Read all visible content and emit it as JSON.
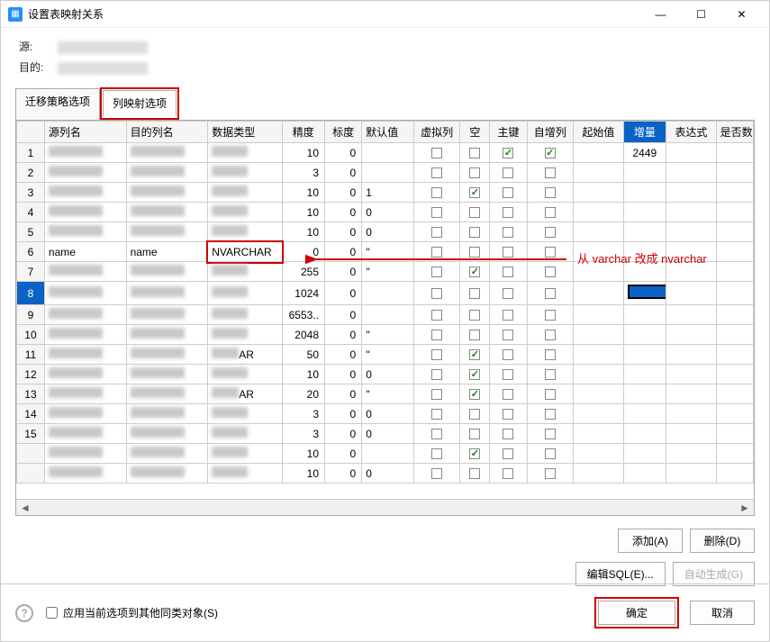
{
  "window": {
    "title": "设置表映射关系",
    "minimize": "—",
    "maximize": "☐",
    "close": "✕"
  },
  "header": {
    "source_label": "源:",
    "target_label": "目的:"
  },
  "tabs": {
    "strategy": "迁移策略选项",
    "mapping": "列映射选项"
  },
  "columns": {
    "rownum": "",
    "src": "源列名",
    "dst": "目的列名",
    "dtype": "数据类型",
    "precision": "精度",
    "scale": "标度",
    "default": "默认值",
    "virtual": "虚拟列",
    "nullable": "空",
    "pk": "主键",
    "autoinc": "自增列",
    "start": "起始值",
    "incr": "增量",
    "expr": "表达式",
    "isnum": "是否数"
  },
  "rows": [
    {
      "n": "1",
      "src": "blur",
      "dst": "blur",
      "dtype": "blur",
      "prec": "10",
      "scale": "0",
      "def": "",
      "v": false,
      "nul": false,
      "pk": true,
      "ai": true,
      "start": "",
      "incr": "2449"
    },
    {
      "n": "2",
      "src": "blur",
      "dst": "blur",
      "dtype": "blur",
      "prec": "3",
      "scale": "0",
      "def": "",
      "v": false,
      "nul": false,
      "pk": false,
      "ai": false,
      "start": "",
      "incr": ""
    },
    {
      "n": "3",
      "src": "blur",
      "dst": "blur",
      "dtype": "blur",
      "prec": "10",
      "scale": "0",
      "def": "1",
      "v": false,
      "nul": true,
      "pk": false,
      "ai": false,
      "start": "",
      "incr": ""
    },
    {
      "n": "4",
      "src": "blur",
      "dst": "blur",
      "dtype": "blur",
      "prec": "10",
      "scale": "0",
      "def": "0",
      "v": false,
      "nul": false,
      "pk": false,
      "ai": false,
      "start": "",
      "incr": ""
    },
    {
      "n": "5",
      "src": "blur",
      "dst": "blur",
      "dtype": "blur",
      "prec": "10",
      "scale": "0",
      "def": "0",
      "v": false,
      "nul": false,
      "pk": false,
      "ai": false,
      "start": "",
      "incr": ""
    },
    {
      "n": "6",
      "src": "name",
      "dst": "name",
      "dtype": "NVARCHAR",
      "prec": "0",
      "scale": "0",
      "def": "''",
      "v": false,
      "nul": false,
      "pk": false,
      "ai": false,
      "start": "",
      "incr": "",
      "hl": true
    },
    {
      "n": "7",
      "src": "blur",
      "dst": "blur",
      "dtype": "blur",
      "prec": "255",
      "scale": "0",
      "def": "''",
      "v": false,
      "nul": true,
      "pk": false,
      "ai": false,
      "start": "",
      "incr": ""
    },
    {
      "n": "8",
      "src": "blur",
      "dst": "blur",
      "dtype": "blur",
      "prec": "1024",
      "scale": "0",
      "def": "",
      "v": false,
      "nul": false,
      "pk": false,
      "ai": false,
      "start": "",
      "incr": "black",
      "sel": true
    },
    {
      "n": "9",
      "src": "blur",
      "dst": "blur",
      "dtype": "blur",
      "prec": "6553..",
      "scale": "0",
      "def": "",
      "v": false,
      "nul": false,
      "pk": false,
      "ai": false,
      "start": "",
      "incr": ""
    },
    {
      "n": "10",
      "src": "blur",
      "dst": "blur",
      "dtype": "blur",
      "prec": "2048",
      "scale": "0",
      "def": "''",
      "v": false,
      "nul": false,
      "pk": false,
      "ai": false,
      "start": "",
      "incr": ""
    },
    {
      "n": "11",
      "src": "blur",
      "dst": "blur",
      "dtype": "AR",
      "prec": "50",
      "scale": "0",
      "def": "''",
      "v": false,
      "nul": true,
      "pk": false,
      "ai": false,
      "start": "",
      "incr": ""
    },
    {
      "n": "12",
      "src": "blur",
      "dst": "blur",
      "dtype": "blur",
      "prec": "10",
      "scale": "0",
      "def": "0",
      "v": false,
      "nul": true,
      "pk": false,
      "ai": false,
      "start": "",
      "incr": ""
    },
    {
      "n": "13",
      "src": "blur",
      "dst": "blur",
      "dtype": "AR",
      "prec": "20",
      "scale": "0",
      "def": "''",
      "v": false,
      "nul": true,
      "pk": false,
      "ai": false,
      "start": "",
      "incr": ""
    },
    {
      "n": "14",
      "src": "blur",
      "dst": "blur",
      "dtype": "blur",
      "prec": "3",
      "scale": "0",
      "def": "0",
      "v": false,
      "nul": false,
      "pk": false,
      "ai": false,
      "start": "",
      "incr": ""
    },
    {
      "n": "15",
      "src": "blur",
      "dst": "blur",
      "dtype": "blur",
      "prec": "3",
      "scale": "0",
      "def": "0",
      "v": false,
      "nul": false,
      "pk": false,
      "ai": false,
      "start": "",
      "incr": ""
    },
    {
      "n": "",
      "src": "blur",
      "dst": "blur",
      "dtype": "blur",
      "prec": "10",
      "scale": "0",
      "def": "",
      "v": false,
      "nul": true,
      "pk": false,
      "ai": false,
      "start": "",
      "incr": ""
    },
    {
      "n": "",
      "src": "blur",
      "dst": "blur",
      "dtype": "blur",
      "prec": "10",
      "scale": "0",
      "def": "0",
      "v": false,
      "nul": false,
      "pk": false,
      "ai": false,
      "start": "",
      "incr": ""
    }
  ],
  "buttons": {
    "add": "添加(A)",
    "delete": "删除(D)",
    "editsql": "编辑SQL(E)...",
    "autogen": "自动生成(G)",
    "ok": "确定",
    "cancel": "取消"
  },
  "footer": {
    "apply_label": "应用当前选项到其他同类对象(S)"
  },
  "annotation": "从 varchar 改成 nvarchar"
}
